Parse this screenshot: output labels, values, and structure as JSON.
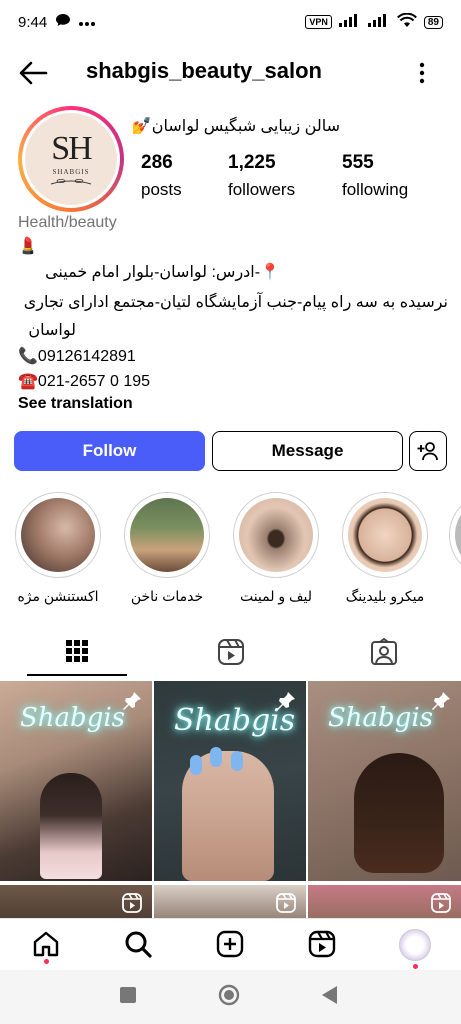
{
  "status_bar": {
    "time": "9:44",
    "vpn": "VPN",
    "battery": "89"
  },
  "header": {
    "username": "shabgis_beauty_salon"
  },
  "profile": {
    "avatar_initials": "SH",
    "avatar_name": "SHABGIS",
    "full_name": "سالن زیبایی شبگیس لواسان💅",
    "stats": [
      {
        "value": "286",
        "label": "posts"
      },
      {
        "value": "1,225",
        "label": "followers"
      },
      {
        "value": "555",
        "label": "following"
      }
    ],
    "category": "Health/beauty",
    "bio_lines": [
      "💄",
      "📍-ادرس: لواسان-بلوار امام خمینی",
      "نرسیده به سه راه پیام-جنب آزمایشگاه لتیان-مجتمع ادارای تجاری",
      "لواسان",
      "📞09126142891",
      "☎️021-2657 0 195"
    ],
    "see_translation": "See translation"
  },
  "actions": {
    "follow": "Follow",
    "message": "Message"
  },
  "highlights": [
    {
      "label": "اکستنشن مژه"
    },
    {
      "label": "خدمات ناخن"
    },
    {
      "label": "لیف و لمینت"
    },
    {
      "label": "میکرو بلیدینگ"
    }
  ],
  "grid_text": {
    "neon": "Shabgis"
  },
  "icons": [
    "back-arrow-icon",
    "more-vertical-icon",
    "add-user-icon",
    "grid-icon",
    "reels-icon",
    "tagged-icon",
    "pin-icon",
    "reel-icon",
    "home-icon",
    "search-icon",
    "create-icon",
    "profile-avatar-icon"
  ],
  "colors": {
    "follow_button": "#4a5df9",
    "notification_dot": "#ff2d55",
    "category_text": "#737373"
  }
}
